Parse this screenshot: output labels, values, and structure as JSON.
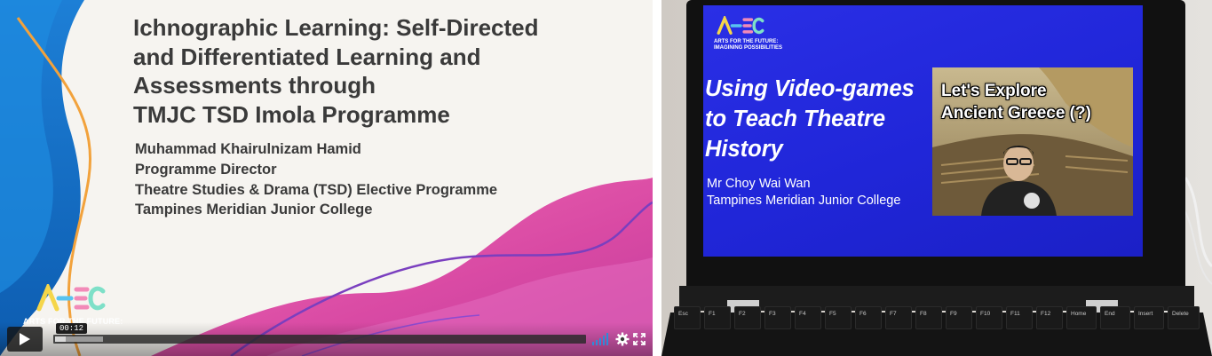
{
  "video_player": {
    "slide": {
      "title": "Ichnographic Learning: Self-Directed\nand Differentiated Learning and\nAssessments through\nTMJC TSD Imola Programme",
      "lines": [
        "Muhammad Khairulnizam Hamid",
        "Programme Director",
        "Theatre Studies & Drama (TSD) Elective Programme",
        "Tampines Meridian Junior College"
      ],
      "logo_caption": "ARTS FOR THE FUTURE:"
    },
    "controls": {
      "play_icon": "play-icon",
      "time_tooltip": "00:12",
      "progress_fraction": 0.02,
      "buffered_fraction": 0.09,
      "volume_icon": "volume-icon",
      "settings_icon": "gear-icon",
      "fullscreen_icon": "fullscreen-icon",
      "accent_color": "#2e8bd8"
    }
  },
  "laptop_photo": {
    "slide": {
      "logo_caption": "ARTS FOR THE FUTURE:\nIMAGINING POSSIBILITIES",
      "title": "Using Video-games\nto Teach Theatre\nHistory",
      "lines": [
        "Mr Choy Wai Wan",
        "Tampines Meridian Junior College"
      ],
      "thumbnail_title": "Let's Explore\nAncient Greece (?)",
      "background_color": "#2026d8"
    },
    "keyboard": {
      "function_keys": [
        "Esc",
        "F1",
        "F2",
        "F3",
        "F4",
        "F5",
        "F6",
        "F7",
        "F8",
        "F9",
        "F10",
        "F11",
        "F12",
        "Home",
        "End",
        "Insert",
        "Delete"
      ]
    }
  }
}
